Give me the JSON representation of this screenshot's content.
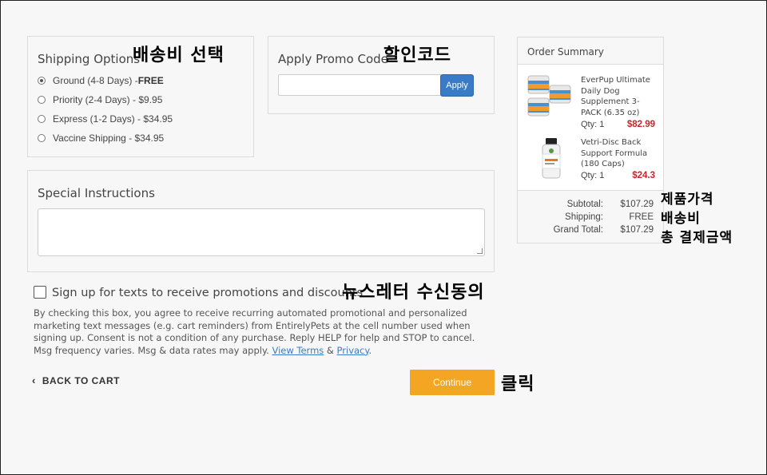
{
  "shipping": {
    "title": "Shipping Options",
    "options": [
      {
        "label": "Ground (4-8 Days) - ",
        "price": "FREE",
        "selected": true
      },
      {
        "label": "Priority (2-4 Days) - $9.95",
        "selected": false
      },
      {
        "label": "Express (1-2 Days) - $34.95",
        "selected": false
      },
      {
        "label": "Vaccine Shipping - $34.95",
        "selected": false
      }
    ]
  },
  "promo": {
    "title": "Apply Promo Code",
    "placeholder": "",
    "apply_label": "Apply"
  },
  "instructions": {
    "title": "Special Instructions",
    "value": ""
  },
  "sms": {
    "label": "Sign up for texts to receive promotions and discounts",
    "consent_text": "By checking this box, you agree to receive recurring automated promotional and personalized marketing text messages (e.g. cart reminders) from EntirelyPets at the cell number used when signing up. Consent is not a condition of any purchase. Reply HELP for help and STOP to cancel. Msg frequency varies. Msg & data rates may apply. ",
    "terms_link": "View Terms",
    "amp": " & ",
    "privacy_link": "Privacy",
    "period": "."
  },
  "nav": {
    "back_label": "BACK TO CART",
    "continue_label": "Continue"
  },
  "summary": {
    "title": "Order Summary",
    "items": [
      {
        "name": "EverPup Ultimate Daily Dog Supplement 3-PACK (6.35 oz)",
        "qty": "Qty: 1",
        "price": "$82.99"
      },
      {
        "name": "Vetri-Disc Back Support Formula (180 Caps)",
        "qty": "Qty: 1",
        "price": "$24.3"
      }
    ],
    "subtotal_label": "Subtotal:",
    "subtotal": "$107.29",
    "shipping_label": "Shipping:",
    "shipping": "FREE",
    "grand_label": "Grand Total:",
    "grand": "$107.29"
  },
  "annotations": {
    "shipping": "배송비 선택",
    "promo": "할인코드",
    "newsletter": "뉴스레터 수신동의",
    "click": "클릭",
    "product_price": "제품가격",
    "shipping_fee": "배송비",
    "total": "총 결제금액"
  },
  "colors": {
    "apply_button": "#3a7bc8",
    "continue_button": "#f4a523",
    "price_red": "#c0282d"
  }
}
